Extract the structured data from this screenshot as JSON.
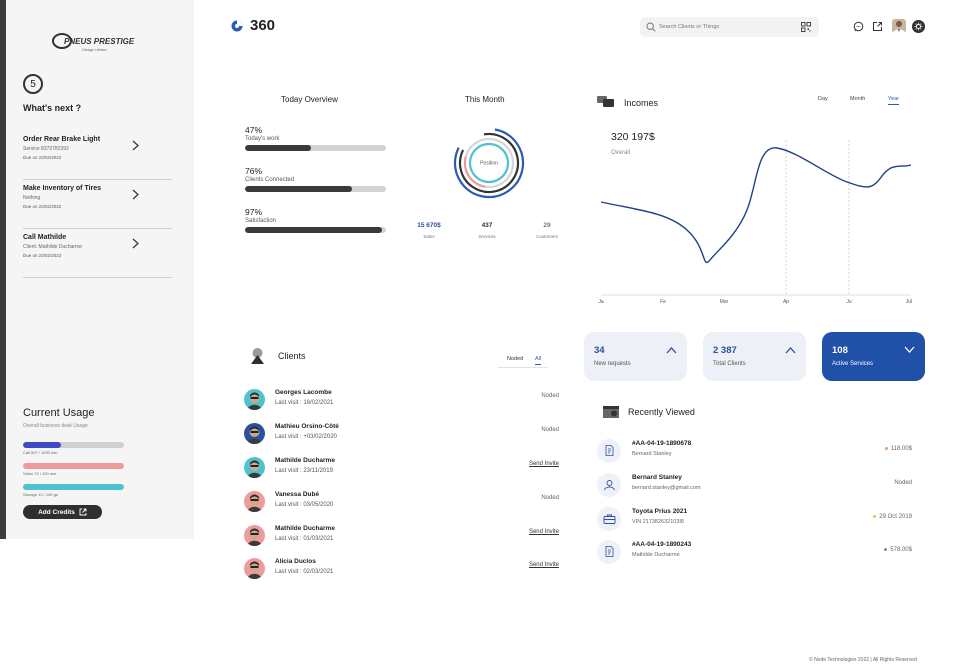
{
  "sidebar": {
    "logo_text": "PNEUS PRESTIGE",
    "logo_sub": "Garage Leblanc",
    "step": "5",
    "whats_next": "What's next ?",
    "tasks": [
      {
        "title": "Order Rear Brake Light",
        "sub": "Service 8372782392",
        "due": "Due on 22/02/2022"
      },
      {
        "title": "Make Inventory of Tires",
        "sub": "Nothing",
        "due": "Due on 22/02/2022"
      },
      {
        "title": "Call Mathilde",
        "sub": "Client: Mathilde Ducharme",
        "due": "Due on 22/02/2022"
      }
    ],
    "current_usage": "Current Usage",
    "usage_sub": "Overall business desk Usage",
    "usage": [
      {
        "label": "Call 597 / 1000 min",
        "fraction": 0.38,
        "color": "#3f4bc4"
      },
      {
        "label": "Video 72 / 100 min",
        "fraction": 1.0,
        "color": "#ee9b9b"
      },
      {
        "label": "Storage 12 / 100 go",
        "fraction": 1.0,
        "color": "#4cc3cf"
      }
    ],
    "add_credits": "Add Credits"
  },
  "header": {
    "brand": "360",
    "search_placeholder": "Search Clients or Things"
  },
  "overview": {
    "title": "Today Overview",
    "items": [
      {
        "pct": "47%",
        "label": "Today's work",
        "fraction": 0.47
      },
      {
        "pct": "76%",
        "label": "Clients Connected",
        "fraction": 0.76
      },
      {
        "pct": "97%",
        "label": "Satisfaction",
        "fraction": 0.97
      }
    ]
  },
  "this_month": {
    "title": "This Month",
    "center_label": "Position",
    "stats": [
      {
        "value": "15 670$",
        "label": "Sales",
        "color": "#2a50a0"
      },
      {
        "value": "437",
        "label": "Services",
        "color": "#333333"
      },
      {
        "value": "29",
        "label": "Customers",
        "color": "#777777"
      }
    ]
  },
  "incomes": {
    "title": "Incomes",
    "tabs": [
      "Day",
      "Month",
      "Year"
    ],
    "active_tab": "Year",
    "total": "320 197$",
    "total_label": "Overall",
    "x_labels": [
      "Ja",
      "Fe",
      "Mar",
      "Ap",
      "Ju",
      "Jul"
    ]
  },
  "chart_data": {
    "type": "line",
    "title": "Incomes",
    "x": [
      "Ja",
      "Fe",
      "Mar",
      "Ap",
      "Ju",
      "Jul"
    ],
    "series": [
      {
        "values": [
          0.62,
          0.55,
          0.3,
          0.45,
          0.88,
          0.72,
          0.78
        ]
      }
    ],
    "grid": "vertical dashed"
  },
  "stats": [
    {
      "value": "34",
      "label": "New requests",
      "active": false
    },
    {
      "value": "2 387",
      "label": "Total Clients",
      "active": false
    },
    {
      "value": "108",
      "label": "Active Services",
      "active": true
    }
  ],
  "clients": {
    "title": "Clients",
    "filters": [
      "Noded",
      "All"
    ],
    "active_filter": "All",
    "list": [
      {
        "name": "Georges Lacombe",
        "visit": "Last visit : 18/02/2021",
        "status": "Noded",
        "link": false,
        "ring": "#4cc3cf"
      },
      {
        "name": "Mathieu Orsino-Côté",
        "visit": "Last visit : +03/02/2020",
        "status": "Noded",
        "link": false,
        "ring": "#2a50a0"
      },
      {
        "name": "Mathilde Ducharme",
        "visit": "Last visit : 23/11/2019",
        "status": "Send Invite",
        "link": true,
        "ring": "#4cc3cf"
      },
      {
        "name": "Vanessa Dubé",
        "visit": "Last visit : 03/05/2020",
        "status": "Noded",
        "link": false,
        "ring": "#ee9b9b"
      },
      {
        "name": "Mathilde Ducharme",
        "visit": "Last visit : 01/03/2021",
        "status": "Send Invite",
        "link": true,
        "ring": "#ee9b9b"
      },
      {
        "name": "Alicia Duclos",
        "visit": "Last visit : 02/03/2021",
        "status": "Send Invite",
        "link": true,
        "ring": "#ee9b9b"
      }
    ]
  },
  "recently_viewed": {
    "title": "Recently Viewed",
    "items": [
      {
        "title": "#AA-04-19-1890678",
        "sub": "Bernard Stanley",
        "right": "118.00$",
        "dot": "#e8a36a",
        "icon": "invoice-icon"
      },
      {
        "title": "Bernard Stanley",
        "sub": "bernard.stanley@gmail.com",
        "right": "Noded",
        "dot": "",
        "icon": "user-icon"
      },
      {
        "title": "Toyota Prius 2021",
        "sub": "VIN 217382632103I8",
        "right": "29 Oct 2019",
        "dot": "#f0c24b",
        "icon": "briefcase-icon"
      },
      {
        "title": "#AA-04-19-1890243",
        "sub": "Mathilde Ducharme",
        "right": "578.00$",
        "dot": "#888888",
        "icon": "invoice-icon"
      }
    ]
  },
  "footer": "© Node Technologies 2022 | All Rights Reserved"
}
